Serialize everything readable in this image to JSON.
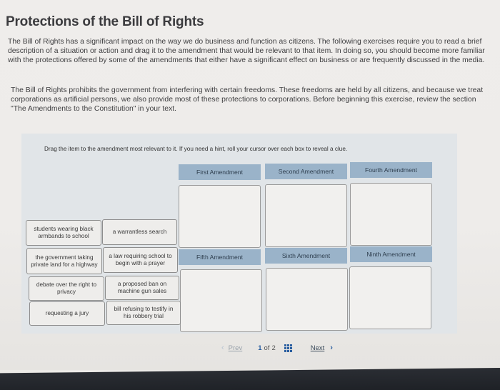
{
  "title": "Protections of the Bill of Rights",
  "intro_paragraphs": [
    "The Bill of Rights has a significant impact on the way we do business and function as citizens. The following exercises require you to read a brief description of a situation or action and drag it to the amendment that would be relevant to that item. In doing so, you should become more familiar with the protections offered by some of the amendments that either have a significant effect on business or are frequently discussed in the media.",
    "The Bill of Rights prohibits the government from interfering with certain freedoms. These freedoms are held by all citizens, and because we treat corporations as artificial persons, we also provide most of these protections to corporations. Before beginning this exercise, review the section \"The Amendments to the Constitution\" in your text."
  ],
  "exercise": {
    "instruction": "Drag the item to the amendment most relevant to it. If you need a hint, roll your cursor over each box to reveal a clue.",
    "amendments": [
      {
        "label": "First Amendment"
      },
      {
        "label": "Second Amendment"
      },
      {
        "label": "Fourth Amendment"
      },
      {
        "label": "Fifth Amendment"
      },
      {
        "label": "Sixth Amendment"
      },
      {
        "label": "Ninth Amendment"
      }
    ],
    "items": [
      {
        "label": "students wearing black armbands to school"
      },
      {
        "label": "a warrantless search"
      },
      {
        "label": "the government taking private land for a highway"
      },
      {
        "label": "a law requiring school to begin with a prayer"
      },
      {
        "label": "debate over the right to privacy"
      },
      {
        "label": "a proposed ban on machine gun sales"
      },
      {
        "label": "requesting a jury"
      },
      {
        "label": "bill refusing to testify in his robbery trial"
      }
    ]
  },
  "pagination": {
    "prev_label": "Prev",
    "current": "1",
    "of_label": "of",
    "total": "2",
    "next_label": "Next",
    "grid_icon": "grid-icon"
  }
}
